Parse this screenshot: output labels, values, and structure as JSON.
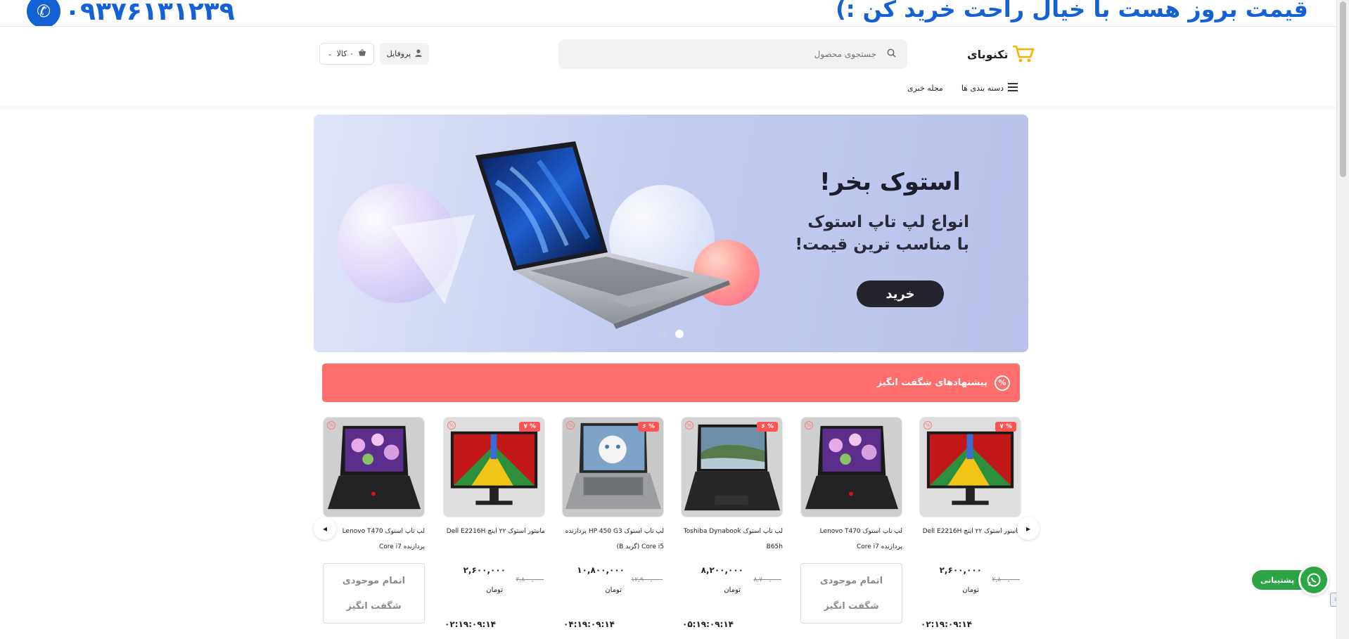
{
  "top_strip": {
    "phone": "۰۹۳۷۶۱۳۱۲۳۹",
    "slogan": "قیمت بروز هست با خیال راحت خرید کن :)"
  },
  "header": {
    "logo_text": "تکنوبای",
    "search_placeholder": "جستجوی محصول",
    "profile_label": "پروفایل",
    "cart_label": "۰ کالا",
    "nav": {
      "categories": "دسته بندی ها",
      "magazine": "مجله خبری"
    }
  },
  "hero": {
    "title": "استوک بخر!",
    "line1": "انواع لپ تاپ استوک",
    "line2": "با مناسب ترین قیمت!",
    "button": "خرید",
    "slides": 2,
    "active_slide": 2
  },
  "offers": {
    "title": "پیشنهادهای شگفت انگیز"
  },
  "products": [
    {
      "title": "مانیتور استوک ۲۲ اینچ Dell E2216H",
      "badge": "۷ %",
      "price_new": "۲,۶۰۰,۰۰۰",
      "price_old": "۲,۸۰۰,۰۰۰",
      "currency": "تومان",
      "timer": "۰۲:۱۹:۰۹:۱۴",
      "type": "monitor"
    },
    {
      "title": "لپ تاپ استوک Lenovo T470 پردازنده Core i7",
      "badge": "",
      "out_of_stock": "اتمام موجودی",
      "amazing": "شگفت انگیز",
      "type": "laptop-flowers"
    },
    {
      "title": "لپ تاپ استوک Toshiba Dynabook B65h",
      "badge": "۶ %",
      "price_new": "۸,۲۰۰,۰۰۰",
      "price_old": "۸,۷۰۰,۰۰۰",
      "currency": "تومان",
      "timer": "۰۵:۱۹:۰۹:۱۴",
      "type": "laptop-landscape"
    },
    {
      "title": "لپ تاپ استوک HP 450 G3 پردازنده Core i5 (گرید B)",
      "badge": "۶ %",
      "price_new": "۱۰,۸۰۰,۰۰۰",
      "price_old": "۱۲,۹۰۰,۰۰۰",
      "currency": "تومان",
      "timer": "۰۴:۱۹:۰۹:۱۴",
      "type": "laptop-cat"
    },
    {
      "title": "مانیتور استوک ۲۲ اینچ Dell E2216H",
      "badge": "۷ %",
      "price_new": "۲,۶۰۰,۰۰۰",
      "price_old": "۲,۸۰۰,۰۰۰",
      "currency": "تومان",
      "timer": "۰۲:۱۹:۰۹:۱۴",
      "type": "monitor"
    },
    {
      "title": "لپ تاپ استوک Lenovo T470 پردازنده Core i7",
      "badge": "",
      "out_of_stock": "اتمام موجودی",
      "amazing": "شگفت انگیز",
      "type": "laptop-flowers"
    }
  ],
  "support": {
    "label": "پشتیبانی"
  },
  "colors": {
    "brand_blue": "#1461d6",
    "offers_red": "#ff6d6d",
    "badge_red": "#ff5454",
    "whatsapp_green": "#2ca645"
  }
}
